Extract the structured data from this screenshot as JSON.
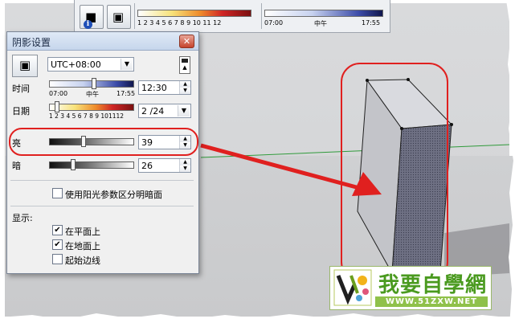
{
  "toolbar": {
    "months": "1 2 3 4 5 6 7 8 9 10 11 12",
    "time_start": "07:00",
    "time_mid": "中午",
    "time_end": "17:55",
    "icons": [
      "info-sun-icon",
      "toggle-shadows-icon"
    ]
  },
  "dialog": {
    "title": "阴影设置",
    "timezone": "UTC+08:00",
    "time_label": "时间",
    "time_start": "07:00",
    "time_mid": "中午",
    "time_end": "17:55",
    "time_value": "12:30",
    "time_slider_fraction": 0.52,
    "date_label": "日期",
    "date_months": "1 2 3 4 5 6 7 8 9 101112",
    "date_value": "2 /24",
    "light_label": "亮",
    "light_value": "39",
    "light_fraction": 0.39,
    "dark_label": "暗",
    "dark_value": "26",
    "dark_fraction": 0.26,
    "use_sun_label": "使用阳光参数区分明暗面",
    "use_sun_checked": false,
    "display_label": "显示:",
    "on_faces_label": "在平面上",
    "on_faces_checked": true,
    "on_ground_label": "在地面上",
    "on_ground_checked": true,
    "from_edges_label": "起始边线",
    "from_edges_checked": false
  },
  "watermark": {
    "title": "我要自學網",
    "url": "WWW.51ZXW.NET"
  },
  "colors": {
    "annotation_red": "#e0201f",
    "ground_line_green": "#2f9a3a",
    "box_dark_face": "#6f7184",
    "box_light_face": "#c3c4c9"
  }
}
